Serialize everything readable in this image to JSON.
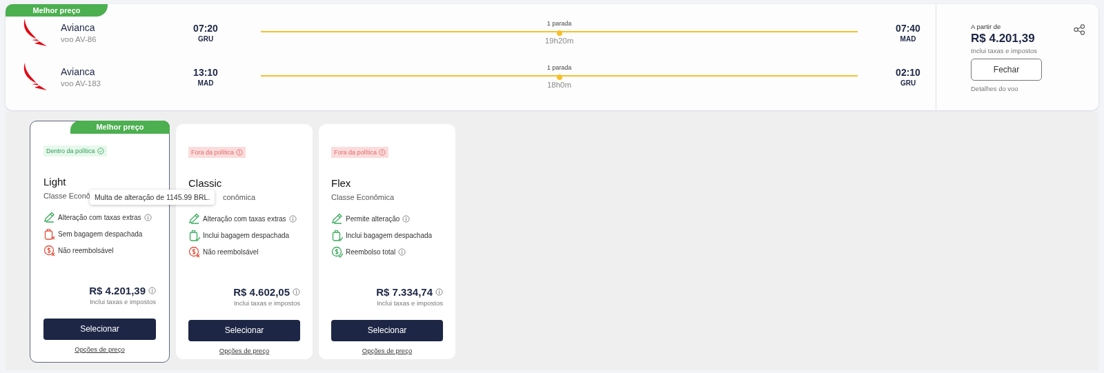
{
  "flight_card": {
    "badge": "Melhor preço",
    "legs": [
      {
        "airline": "Avianca",
        "flight": "voo AV-86",
        "departure": {
          "time": "07:20",
          "airport": "GRU"
        },
        "stops": "1 parada",
        "duration": "19h20m",
        "arrival": {
          "time": "07:40",
          "airport": "MAD"
        }
      },
      {
        "airline": "Avianca",
        "flight": "voo AV-183",
        "departure": {
          "time": "13:10",
          "airport": "MAD"
        },
        "stops": "1 parada",
        "duration": "18h0m",
        "arrival": {
          "time": "02:10",
          "airport": "GRU"
        }
      }
    ],
    "price_panel": {
      "from_label": "A partir de",
      "price": "R$ 4.201,39",
      "taxes_note": "Inclui taxas e impostos",
      "close_button": "Fechar",
      "details_label": "Detalhes do voo"
    }
  },
  "fares": [
    {
      "selected": true,
      "badge": "Melhor preço",
      "policy": {
        "label": "Dentro da política",
        "within": true
      },
      "name": "Light",
      "cabin": "Classe Econô",
      "cabin_covered_start": false,
      "features": [
        {
          "kind": "change",
          "label": "Alteração com taxas extras",
          "included": true,
          "info": true
        },
        {
          "kind": "baggage",
          "label": "Sem bagagem despachada",
          "included": false,
          "info": false
        },
        {
          "kind": "refund",
          "label": "Não reembolsável",
          "included": false,
          "info": false
        }
      ],
      "price": "R$ 4.201,39",
      "taxes_note": "Inclui taxas e impostos",
      "select_button": "Selecionar",
      "options_link": "Opções de preço"
    },
    {
      "selected": false,
      "policy": {
        "label": "Fora da política",
        "within": false
      },
      "name": "Classic",
      "cabin": "conômica",
      "cabin_covered_start": true,
      "features": [
        {
          "kind": "change",
          "label": "Alteração com taxas extras",
          "included": true,
          "info": true
        },
        {
          "kind": "baggage",
          "label": "Inclui bagagem despachada",
          "included": true,
          "info": false
        },
        {
          "kind": "refund",
          "label": "Não reembolsável",
          "included": false,
          "info": false
        }
      ],
      "price": "R$ 4.602,05",
      "taxes_note": "Inclui taxas e impostos",
      "select_button": "Selecionar",
      "options_link": "Opções de preço"
    },
    {
      "selected": false,
      "policy": {
        "label": "Fora da política",
        "within": false
      },
      "name": "Flex",
      "cabin": "Classe Econômica",
      "cabin_covered_start": false,
      "features": [
        {
          "kind": "change",
          "label": "Permite alteração",
          "included": true,
          "info": true
        },
        {
          "kind": "baggage",
          "label": "Inclui bagagem despachada",
          "included": true,
          "info": false
        },
        {
          "kind": "refund",
          "label": "Reembolso total",
          "included": true,
          "info": true
        }
      ],
      "price": "R$ 7.334,74",
      "taxes_note": "Inclui taxas e impostos",
      "select_button": "Selecionar",
      "options_link": "Opções de preço"
    }
  ],
  "tooltip": {
    "text": "Multa de alteração de 1145.99 BRL."
  }
}
